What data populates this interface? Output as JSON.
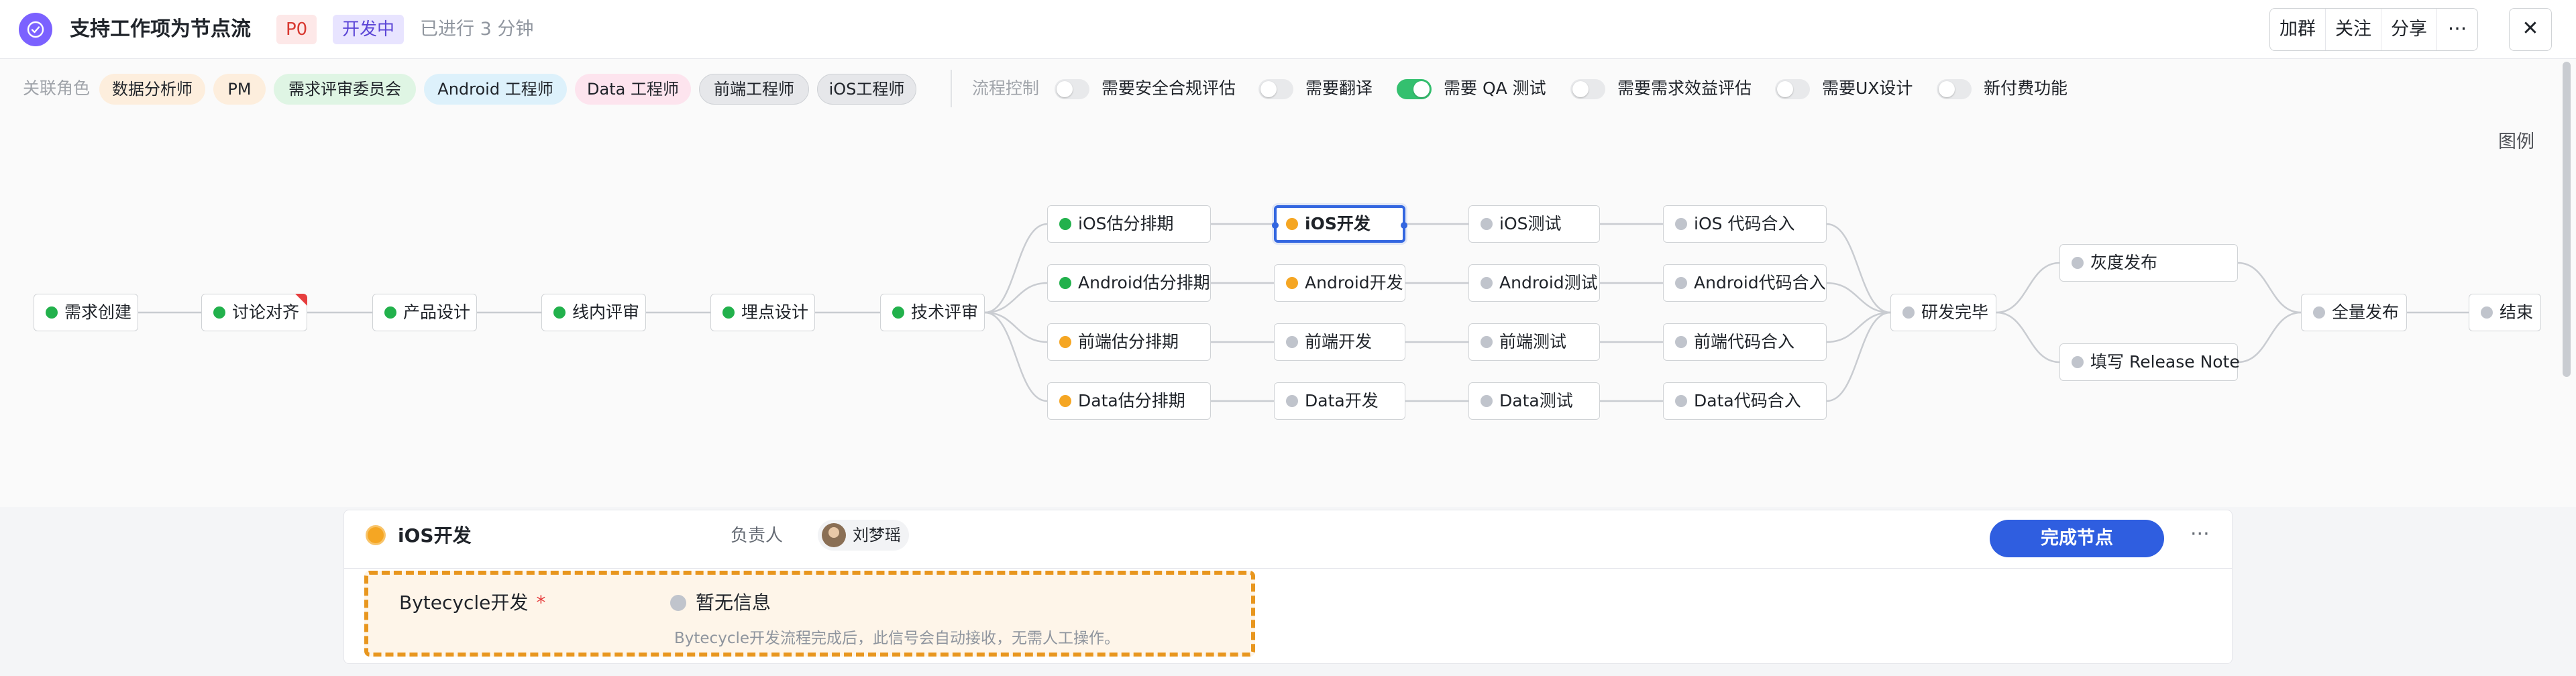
{
  "header": {
    "title": "支持工作项为节点流",
    "priority": "P0",
    "status": "开发中",
    "elapsed": "已进行 3 分钟",
    "buttons": {
      "join_group": "加群",
      "follow": "关注",
      "share": "分享",
      "more": "···"
    },
    "close": "✕",
    "accent_color": "#7b61ff"
  },
  "roles": {
    "label": "关联角色",
    "items": [
      {
        "label": "数据分析师",
        "bg": "#fdeedd",
        "fg": "#1f2329"
      },
      {
        "label": "PM",
        "bg": "#fdeedd",
        "fg": "#1f2329"
      },
      {
        "label": "需求评审委员会",
        "bg": "#dff5e4",
        "fg": "#1f2329"
      },
      {
        "label": "Android 工程师",
        "bg": "#ddf1fb",
        "fg": "#1f2329"
      },
      {
        "label": "Data 工程师",
        "bg": "#fde4ee",
        "fg": "#1f2329"
      },
      {
        "label": "前端工程师",
        "bg": "#e6e7ea",
        "fg": "#1f2329"
      },
      {
        "label": "iOS工程师",
        "bg": "#e6e7ea",
        "fg": "#1f2329"
      }
    ]
  },
  "flow_control": {
    "label": "流程控制",
    "toggles": [
      {
        "label": "需要安全合规评估",
        "on": false
      },
      {
        "label": "需要翻译",
        "on": false
      },
      {
        "label": "需要 QA 测试",
        "on": true
      },
      {
        "label": "需要需求效益评估",
        "on": false
      },
      {
        "label": "需要UX设计",
        "on": false
      },
      {
        "label": "新付费功能",
        "on": false
      }
    ]
  },
  "canvas": {
    "legend": "图例",
    "nodes": [
      {
        "id": "n1",
        "label": "需求创建",
        "state": "green"
      },
      {
        "id": "n2",
        "label": "讨论对齐",
        "state": "green",
        "flag": true
      },
      {
        "id": "n3",
        "label": "产品设计",
        "state": "green"
      },
      {
        "id": "n4",
        "label": "线内评审",
        "state": "green"
      },
      {
        "id": "n5",
        "label": "埋点设计",
        "state": "green"
      },
      {
        "id": "n6",
        "label": "技术评审",
        "state": "green"
      },
      {
        "id": "a1",
        "label": "iOS估分排期",
        "state": "green"
      },
      {
        "id": "a2",
        "label": "Android估分排期",
        "state": "green"
      },
      {
        "id": "a3",
        "label": "前端估分排期",
        "state": "orange"
      },
      {
        "id": "a4",
        "label": "Data估分排期",
        "state": "orange"
      },
      {
        "id": "b1",
        "label": "iOS开发",
        "state": "orange",
        "active": true
      },
      {
        "id": "b2",
        "label": "Android开发",
        "state": "orange"
      },
      {
        "id": "b3",
        "label": "前端开发",
        "state": "gray"
      },
      {
        "id": "b4",
        "label": "Data开发",
        "state": "gray"
      },
      {
        "id": "c1",
        "label": "iOS测试",
        "state": "gray"
      },
      {
        "id": "c2",
        "label": "Android测试",
        "state": "gray"
      },
      {
        "id": "c3",
        "label": "前端测试",
        "state": "gray"
      },
      {
        "id": "c4",
        "label": "Data测试",
        "state": "gray"
      },
      {
        "id": "d1",
        "label": "iOS 代码合入",
        "state": "gray"
      },
      {
        "id": "d2",
        "label": "Android代码合入",
        "state": "gray"
      },
      {
        "id": "d3",
        "label": "前端代码合入",
        "state": "gray"
      },
      {
        "id": "d4",
        "label": "Data代码合入",
        "state": "gray"
      },
      {
        "id": "e1",
        "label": "研发完毕",
        "state": "gray"
      },
      {
        "id": "f1",
        "label": "灰度发布",
        "state": "gray"
      },
      {
        "id": "f2",
        "label": "填写 Release Note",
        "state": "gray"
      },
      {
        "id": "g1",
        "label": "全量发布",
        "state": "gray"
      },
      {
        "id": "g2",
        "label": "结束",
        "state": "gray"
      }
    ],
    "edges": [
      [
        "n1",
        "n2"
      ],
      [
        "n2",
        "n3"
      ],
      [
        "n3",
        "n4"
      ],
      [
        "n4",
        "n5"
      ],
      [
        "n5",
        "n6"
      ],
      [
        "n6",
        "a1"
      ],
      [
        "n6",
        "a2"
      ],
      [
        "n6",
        "a3"
      ],
      [
        "n6",
        "a4"
      ],
      [
        "a1",
        "b1"
      ],
      [
        "a2",
        "b2"
      ],
      [
        "a3",
        "b3"
      ],
      [
        "a4",
        "b4"
      ],
      [
        "b1",
        "c1"
      ],
      [
        "b2",
        "c2"
      ],
      [
        "b3",
        "c3"
      ],
      [
        "b4",
        "c4"
      ],
      [
        "c1",
        "d1"
      ],
      [
        "c2",
        "d2"
      ],
      [
        "c3",
        "d3"
      ],
      [
        "c4",
        "d4"
      ],
      [
        "d1",
        "e1"
      ],
      [
        "d2",
        "e1"
      ],
      [
        "d3",
        "e1"
      ],
      [
        "d4",
        "e1"
      ],
      [
        "e1",
        "f1"
      ],
      [
        "e1",
        "f2"
      ],
      [
        "f1",
        "g1"
      ],
      [
        "f2",
        "g1"
      ],
      [
        "g1",
        "g2"
      ]
    ],
    "colors": {
      "green": "#22b14c",
      "orange": "#f5a623",
      "gray": "#c0c4cc",
      "active_border": "#3366e0",
      "edge": "#c9ccd1"
    }
  },
  "panel": {
    "node_name": "iOS开发",
    "owner_label": "负责人",
    "owner_name": "刘梦瑶",
    "complete_button": "完成节点",
    "more": "···",
    "signal": {
      "name": "Bytecycle开发",
      "required_mark": "*",
      "status": "暂无信息",
      "description": "Bytecycle开发流程完成后，此信号会自动接收，无需人工操作。"
    }
  }
}
